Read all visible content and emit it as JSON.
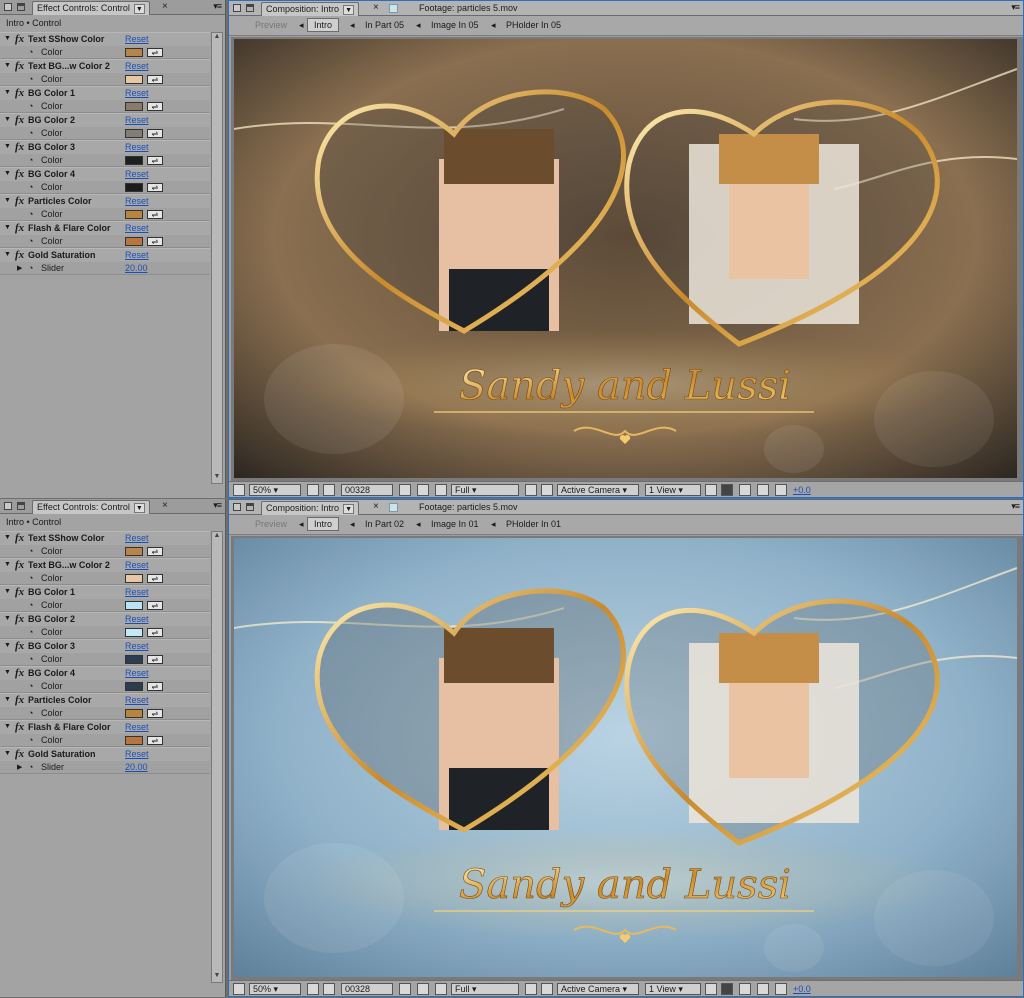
{
  "panels": [
    {
      "effect_controls": {
        "tab_label": "Effect Controls: Control",
        "breadcrumb": "Intro • Control",
        "effects": [
          {
            "name": "Text SShow Color",
            "reset": "Reset",
            "param": "Color",
            "color": "#b8844a"
          },
          {
            "name": "Text BG...w Color 2",
            "reset": "Reset",
            "param": "Color",
            "color": "#e6c8a6"
          },
          {
            "name": "BG Color 1",
            "reset": "Reset",
            "param": "Color",
            "color": "#8a7a69"
          },
          {
            "name": "BG Color 2",
            "reset": "Reset",
            "param": "Color",
            "color": "#847c76"
          },
          {
            "name": "BG Color 3",
            "reset": "Reset",
            "param": "Color",
            "color": "#1f1f1f"
          },
          {
            "name": "BG Color 4",
            "reset": "Reset",
            "param": "Color",
            "color": "#1b1b1b"
          },
          {
            "name": "Particles Color",
            "reset": "Reset",
            "param": "Color",
            "color": "#b8853e"
          },
          {
            "name": "Flash & Flare Color",
            "reset": "Reset",
            "param": "Color",
            "color": "#b8763e"
          }
        ],
        "slider_effect": {
          "name": "Gold Saturation",
          "reset": "Reset",
          "param": "Slider",
          "value": "20.00"
        }
      },
      "composition": {
        "tab_label": "Composition: Intro",
        "footage_label": "Footage: particles 5.mov",
        "flow": {
          "preview": "Preview",
          "current": "Intro",
          "items": [
            "In Part 05",
            "Image In 05",
            "PHolder In 05"
          ]
        },
        "title_text": "Sandy and Lussi",
        "bg_colors": [
          "#5c4a38",
          "#2a2520",
          "#8a6f50"
        ],
        "viewer_bar": {
          "zoom": "50%",
          "timecode": "00328",
          "resolution": "Full",
          "camera": "Active Camera",
          "views": "1 View",
          "exposure": "+0.0"
        }
      }
    },
    {
      "effect_controls": {
        "tab_label": "Effect Controls: Control",
        "breadcrumb": "Intro • Control",
        "effects": [
          {
            "name": "Text SShow Color",
            "reset": "Reset",
            "param": "Color",
            "color": "#b8844a"
          },
          {
            "name": "Text BG...w Color 2",
            "reset": "Reset",
            "param": "Color",
            "color": "#e6c8a6"
          },
          {
            "name": "BG Color 1",
            "reset": "Reset",
            "param": "Color",
            "color": "#b8e2f5"
          },
          {
            "name": "BG Color 2",
            "reset": "Reset",
            "param": "Color",
            "color": "#c3e8f7"
          },
          {
            "name": "BG Color 3",
            "reset": "Reset",
            "param": "Color",
            "color": "#2b3d4f"
          },
          {
            "name": "BG Color 4",
            "reset": "Reset",
            "param": "Color",
            "color": "#2a3c4e"
          },
          {
            "name": "Particles Color",
            "reset": "Reset",
            "param": "Color",
            "color": "#b8853e"
          },
          {
            "name": "Flash & Flare Color",
            "reset": "Reset",
            "param": "Color",
            "color": "#b8763e"
          }
        ],
        "slider_effect": {
          "name": "Gold Saturation",
          "reset": "Reset",
          "param": "Slider",
          "value": "20.00"
        }
      },
      "composition": {
        "tab_label": "Composition: Intro",
        "footage_label": "Footage: particles 5.mov",
        "flow": {
          "preview": "Preview",
          "current": "Intro",
          "items": [
            "In Part 02",
            "Image In 01",
            "PHolder In 01"
          ]
        },
        "title_text": "Sandy and Lussi",
        "bg_colors": [
          "#b9d3e3",
          "#5e7f99",
          "#8fb1c8"
        ],
        "viewer_bar": {
          "zoom": "50%",
          "timecode": "00328",
          "resolution": "Full",
          "camera": "Active Camera",
          "views": "1 View",
          "exposure": "+0.0"
        }
      }
    }
  ]
}
